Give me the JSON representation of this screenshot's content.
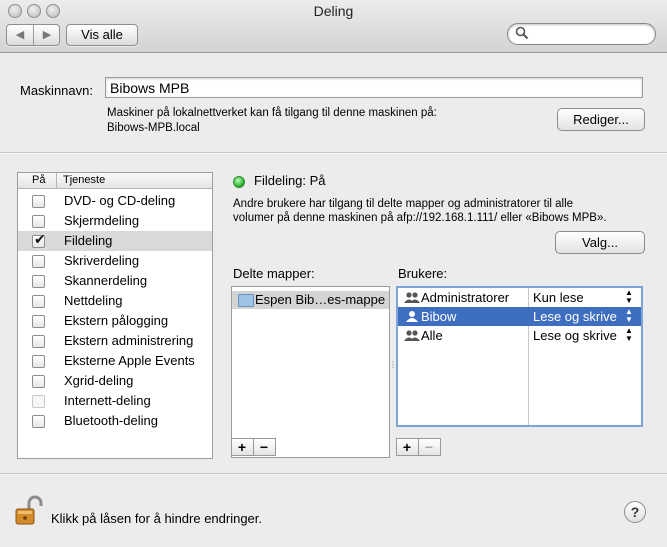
{
  "window": {
    "title": "Deling"
  },
  "toolbar": {
    "back_icon": "chevron-left",
    "forward_icon": "chevron-right",
    "show_all_label": "Vis alle",
    "search": {
      "value": "",
      "placeholder": ""
    }
  },
  "computer": {
    "name_label": "Maskinnavn:",
    "name_value": "Bibows MPB",
    "access_info_line1": "Maskiner på lokalnettverket kan få tilgang til denne maskinen på:",
    "access_info_line2": "Bibows-MPB.local",
    "edit_label": "Rediger..."
  },
  "services": {
    "header_on": "På",
    "header_service": "Tjeneste",
    "items": [
      {
        "label": "DVD- og CD-deling",
        "checked": false,
        "enabled": true
      },
      {
        "label": "Skjermdeling",
        "checked": false,
        "enabled": true
      },
      {
        "label": "Fildeling",
        "checked": true,
        "enabled": true,
        "selected": true
      },
      {
        "label": "Skriverdeling",
        "checked": false,
        "enabled": true
      },
      {
        "label": "Skannerdeling",
        "checked": false,
        "enabled": true
      },
      {
        "label": "Nettdeling",
        "checked": false,
        "enabled": true
      },
      {
        "label": "Ekstern pålogging",
        "checked": false,
        "enabled": true
      },
      {
        "label": "Ekstern administrering",
        "checked": false,
        "enabled": true
      },
      {
        "label": "Eksterne Apple Events",
        "checked": false,
        "enabled": true
      },
      {
        "label": "Xgrid-deling",
        "checked": false,
        "enabled": true
      },
      {
        "label": "Internett-deling",
        "checked": false,
        "enabled": false
      },
      {
        "label": "Bluetooth-deling",
        "checked": false,
        "enabled": true
      }
    ]
  },
  "file_sharing": {
    "status": "Fildeling: På",
    "status_color": "#22aa22",
    "desc_line1": "Andre brukere har tilgang til delte mapper og administratorer til alle",
    "desc_line2": "volumer på denne maskinen på afp://192.168.1.111/ eller «Bibows MPB».",
    "options_label": "Valg...",
    "shared_folders_label": "Delte mapper:",
    "users_label": "Brukere:",
    "folders": [
      {
        "label": "Espen Bib…es-mappe",
        "icon": "folder-icon"
      }
    ],
    "users": [
      {
        "name": "Administratorer",
        "permission": "Kun lese",
        "icon": "group-icon"
      },
      {
        "name": "Bibow",
        "permission": "Lese og skrive",
        "icon": "user-icon",
        "selected": true
      },
      {
        "name": "Alle",
        "permission": "Lese og skrive",
        "icon": "group-icon"
      }
    ],
    "add_label": "+",
    "remove_label": "−"
  },
  "footer": {
    "lock_text": "Klikk på låsen for å hindre endringer.",
    "help_label": "?"
  }
}
